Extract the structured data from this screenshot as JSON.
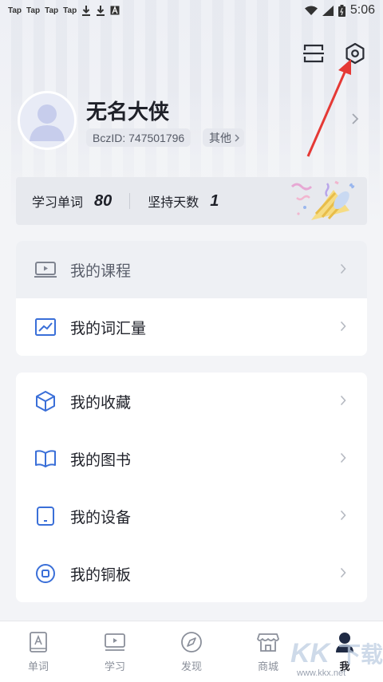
{
  "status_bar": {
    "notifications": [
      "Tap",
      "Tap",
      "Tap",
      "Tap"
    ],
    "time": "5:06"
  },
  "profile": {
    "name": "无名大侠",
    "id_label": "BczID: 747501796",
    "other_label": "其他"
  },
  "stats": {
    "words_label": "学习单词",
    "words_value": "80",
    "days_label": "坚持天数",
    "days_value": "1"
  },
  "menu_group_1": [
    {
      "label": "我的课程",
      "icon": "course-play-icon",
      "active": true
    },
    {
      "label": "我的词汇量",
      "icon": "trend-chart-icon",
      "active": false
    }
  ],
  "menu_group_2": [
    {
      "label": "我的收藏",
      "icon": "cube-icon"
    },
    {
      "label": "我的图书",
      "icon": "book-icon"
    },
    {
      "label": "我的设备",
      "icon": "device-icon"
    },
    {
      "label": "我的铜板",
      "icon": "coin-icon"
    }
  ],
  "bottom_nav": [
    {
      "label": "单词",
      "icon": "word-card-icon"
    },
    {
      "label": "学习",
      "icon": "study-screen-icon"
    },
    {
      "label": "发现",
      "icon": "compass-icon"
    },
    {
      "label": "商城",
      "icon": "store-icon"
    },
    {
      "label": "我",
      "icon": "user-icon",
      "active": true
    }
  ],
  "watermark": {
    "logo_text": "KK下载",
    "url": "www.kkx.net"
  },
  "colors": {
    "accent_blue": "#3a6fd8",
    "annotation_red": "#e53935",
    "text_dark": "#1f2129",
    "text_muted": "#8a8f9a"
  }
}
